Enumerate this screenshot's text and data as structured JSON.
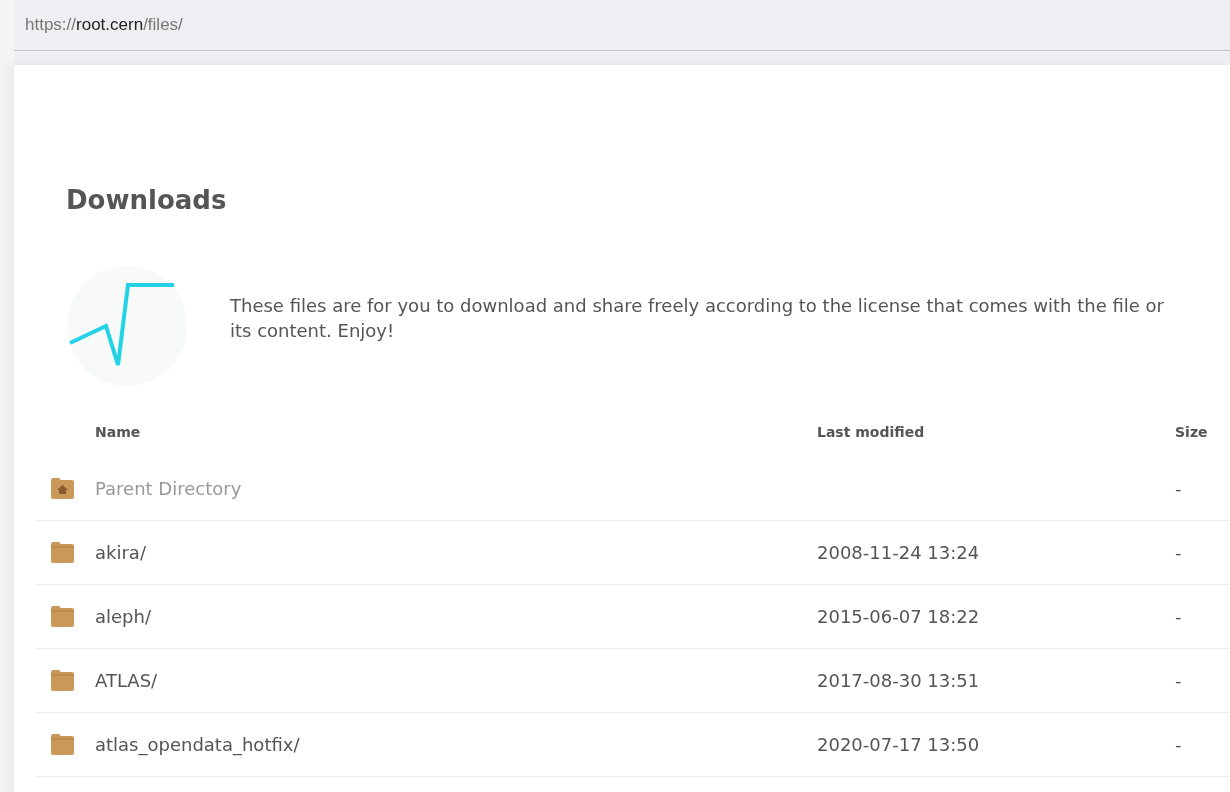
{
  "address_bar": {
    "url": "https://**root.cern**/files/"
  },
  "heading": "Downloads",
  "intro": "These files are for you to download and share freely according to the license that comes with the file or its content. Enjoy!",
  "table": {
    "columns": [
      "Name",
      "Last modified",
      "Size"
    ],
    "rows": [
      {
        "kind": "parent",
        "name": "Parent Directory",
        "size": "-"
      },
      {
        "kind": "folder",
        "name": "akira/",
        "modified": "2008-11-24 13:24",
        "size": "-"
      },
      {
        "kind": "folder",
        "name": "aleph/",
        "modified": "2015-06-07 18:22",
        "size": "-"
      },
      {
        "kind": "folder",
        "name": "ATLAS/",
        "modified": "2017-08-30 13:51",
        "size": "-"
      },
      {
        "kind": "folder",
        "name": "atlas_opendata_hotfix/",
        "modified": "2020-07-17 13:50",
        "size": "-"
      }
    ]
  }
}
